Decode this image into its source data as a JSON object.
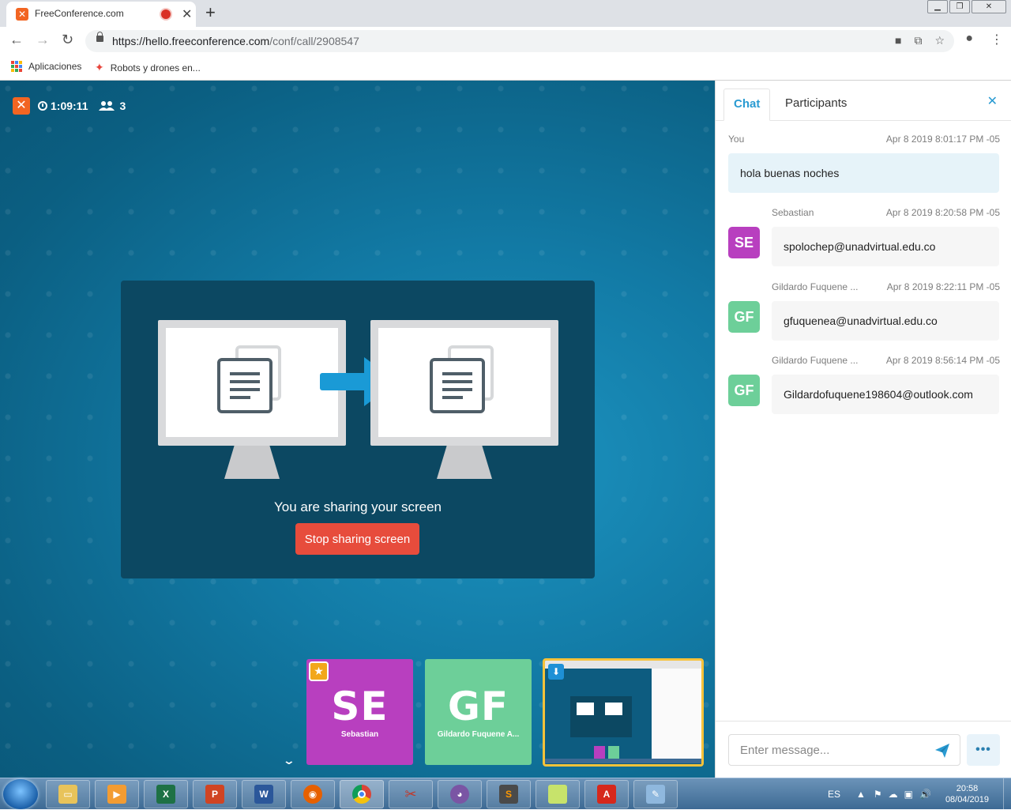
{
  "browser": {
    "tab_title": "FreeConference.com",
    "url_host": "https://hello.freeconference.com",
    "url_path": "/conf/call/2908547",
    "bookmarks": [
      "Aplicaciones",
      "Robots y drones en..."
    ]
  },
  "conference": {
    "duration": "1:09:11",
    "participant_count": "3",
    "share_message": "You are sharing your screen",
    "stop_button": "Stop sharing screen",
    "tiles": [
      {
        "initials": "SE",
        "name": "Sebastian",
        "color": "#b83fbf"
      },
      {
        "initials": "GF",
        "name": "Gildardo Fuquene A...",
        "color": "#6dcf99"
      }
    ]
  },
  "panel": {
    "tabs": [
      "Chat",
      "Participants"
    ],
    "messages": [
      {
        "sender": "You",
        "time": "Apr 8 2019 8:01:17 PM -05",
        "text": "hola buenas noches"
      },
      {
        "sender": "Sebastian",
        "initials": "SE",
        "color": "#b83fbf",
        "time": "Apr 8 2019 8:20:58 PM -05",
        "text": "spolochep@unadvirtual.edu.co"
      },
      {
        "sender": "Gildardo Fuquene ...",
        "initials": "GF",
        "color": "#6dcf99",
        "time": "Apr 8 2019 8:22:11 PM -05",
        "text": "gfuquenea@unadvirtual.edu.co"
      },
      {
        "sender": "Gildardo Fuquene ...",
        "initials": "GF",
        "color": "#6dcf99",
        "time": "Apr 8 2019 8:56:14 PM -05",
        "text": "Gildardofuquene198604@outlook.com"
      }
    ],
    "input_placeholder": "Enter message..."
  },
  "taskbar": {
    "lang": "ES",
    "time": "20:58",
    "date": "08/04/2019"
  }
}
